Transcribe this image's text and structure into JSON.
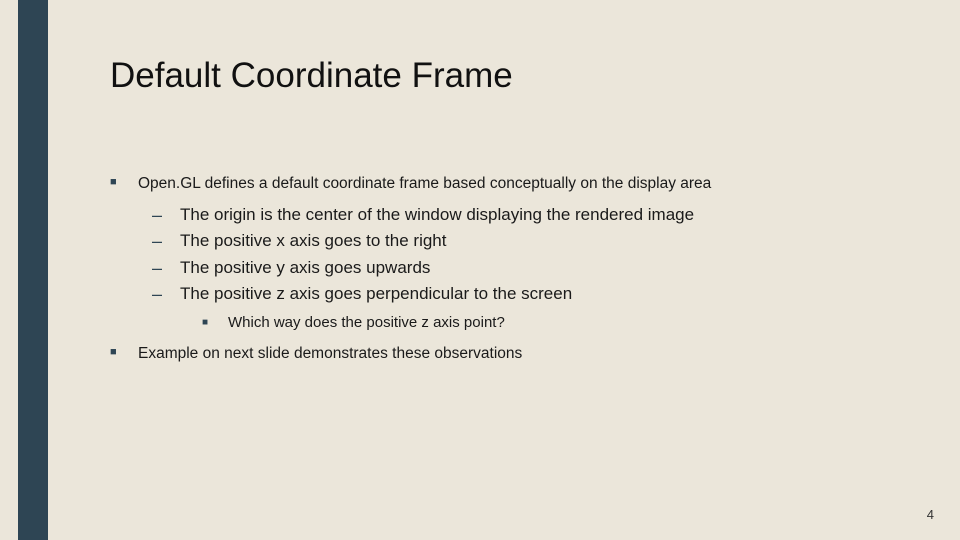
{
  "title": "Default Coordinate Frame",
  "bullets": {
    "b1": "Open.GL defines a default coordinate frame based conceptually on the display area",
    "b1_sub": {
      "s1": "The origin is the center of the window displaying the rendered image",
      "s2": "The positive x axis goes to the right",
      "s3": "The positive y axis goes upwards",
      "s4": "The positive z axis goes perpendicular to the screen",
      "s4_sub": {
        "q1": "Which way does the positive z axis point?"
      }
    },
    "b2": "Example on next slide demonstrates these observations"
  },
  "page_number": "4"
}
